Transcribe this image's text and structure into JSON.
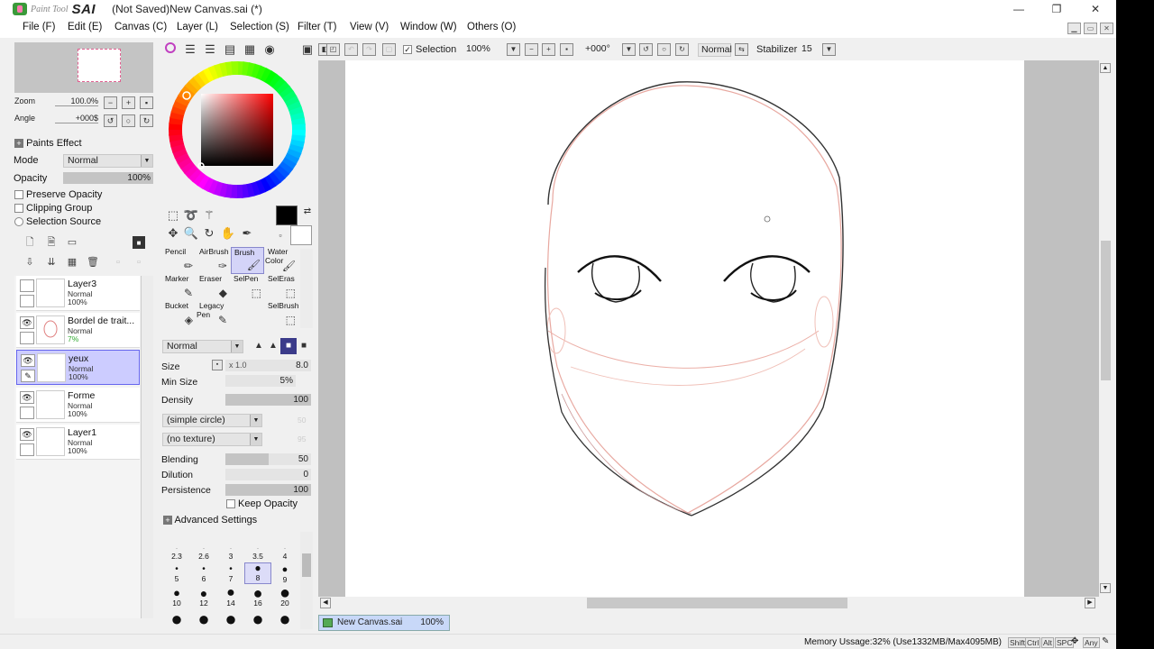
{
  "app": {
    "logo_small": "Paint Tool",
    "logo_large": "SAI",
    "window_title": "(Not Saved)New Canvas.sai (*)"
  },
  "window_controls": {
    "minimize": "—",
    "restore": "❐",
    "close": "✕"
  },
  "menu": [
    "File (F)",
    "Edit (E)",
    "Canvas (C)",
    "Layer (L)",
    "Selection (S)",
    "Filter (T)",
    "View (V)",
    "Window (W)",
    "Others (O)"
  ],
  "navigator": {
    "zoom_label": "Zoom",
    "zoom_value": "100.0%",
    "angle_label": "Angle",
    "angle_value": "+000$"
  },
  "paints_effect": {
    "header": "Paints Effect",
    "mode_label": "Mode",
    "mode_value": "Normal",
    "opacity_label": "Opacity",
    "opacity_value": "100%",
    "opacity_fraction": 1.0,
    "preserve_opacity": "Preserve Opacity",
    "clipping_group": "Clipping Group",
    "selection_source": "Selection Source"
  },
  "layers": [
    {
      "name": "Layer3",
      "mode": "Normal",
      "opacity": "100%",
      "visible": false,
      "selected": false
    },
    {
      "name": "Bordel de trait...",
      "mode": "Normal",
      "opacity": "7%",
      "visible": true,
      "selected": false
    },
    {
      "name": "yeux",
      "mode": "Normal",
      "opacity": "100%",
      "visible": true,
      "selected": true
    },
    {
      "name": "Forme",
      "mode": "Normal",
      "opacity": "100%",
      "visible": true,
      "selected": false
    },
    {
      "name": "Layer1",
      "mode": "Normal",
      "opacity": "100%",
      "visible": true,
      "selected": false
    }
  ],
  "tools": [
    {
      "label": "Pencil"
    },
    {
      "label": "AirBrush"
    },
    {
      "label": "Brush"
    },
    {
      "label": "Water Color"
    },
    {
      "label": "Marker"
    },
    {
      "label": "Eraser"
    },
    {
      "label": "SelPen"
    },
    {
      "label": "SelEras"
    },
    {
      "label": "Bucket"
    },
    {
      "label": "Legacy Pen"
    },
    {
      "label": ""
    },
    {
      "label": "SelBrush"
    }
  ],
  "active_tool": "Brush",
  "brush_settings": {
    "blend_mode": "Normal",
    "size_label": "Size",
    "size_mult": "x 1.0",
    "size_value": "8.0",
    "min_size_label": "Min Size",
    "min_size_value": "5%",
    "density_label": "Density",
    "density_value": "100",
    "shape": "(simple circle)",
    "texture": "(no texture)",
    "shape_strength": "50",
    "texture_strength": "95",
    "blending_label": "Blending",
    "blending_value": "50",
    "dilution_label": "Dilution",
    "dilution_value": "0",
    "persistence_label": "Persistence",
    "persistence_value": "100",
    "keep_opacity": "Keep Opacity",
    "advanced": "Advanced Settings"
  },
  "brush_sizes_row1": [
    "2.3",
    "2.6",
    "3",
    "3.5",
    "4"
  ],
  "brush_sizes_row2": [
    "5",
    "6",
    "7",
    "8",
    "9"
  ],
  "brush_sizes_row3": [
    "10",
    "12",
    "14",
    "16",
    "20"
  ],
  "canvas_toolbar": {
    "selection_label": "Selection",
    "zoom": "100%",
    "angle": "+000°",
    "mode": "Normal",
    "stabilizer_label": "Stabilizer",
    "stabilizer_value": "15"
  },
  "document_tab": {
    "name": "New Canvas.sai",
    "zoom": "100%"
  },
  "status": {
    "memory": "Memory Ussage:32% (Use1332MB/Max4095MB)",
    "keys": [
      "Shift",
      "Ctrl",
      "Alt",
      "SPC",
      "Any"
    ]
  },
  "colors": {
    "primary": "#000000",
    "secondary": "#ffffff",
    "selected_layer": "#ccccff",
    "paper": "#ffffff",
    "canvas_bg": "#c0c0c0"
  }
}
